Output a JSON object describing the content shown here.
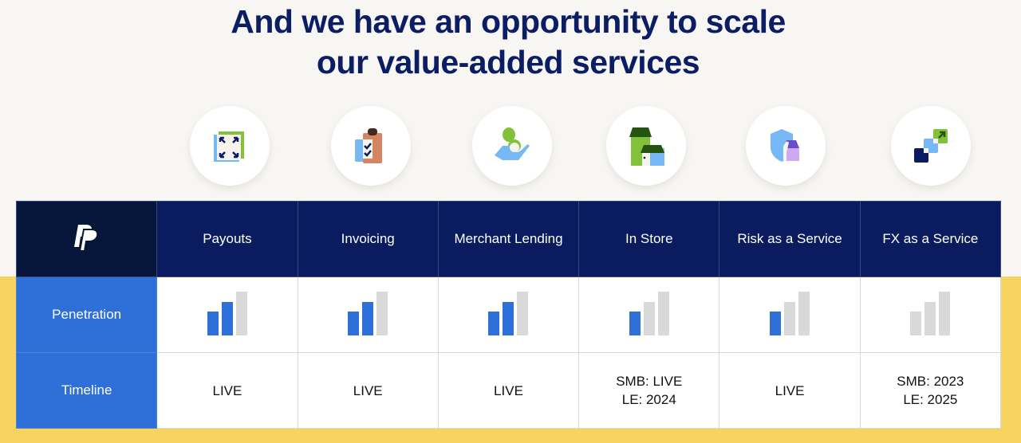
{
  "title_line1": "And we have an opportunity to scale",
  "title_line2": "our value-added services",
  "colors": {
    "navy": "#0a1b5f",
    "blue": "#2f6fd8",
    "bar_filled": "#2f6fd8",
    "bar_empty": "#d9d9d9",
    "yellow": "#f7d35f"
  },
  "row_labels": {
    "penetration": "Penetration",
    "timeline": "Timeline"
  },
  "services": [
    {
      "name": "Payouts",
      "icon": "expand-icon",
      "penetration_bars": 2,
      "timeline": [
        "LIVE"
      ]
    },
    {
      "name": "Invoicing",
      "icon": "clipboard-checklist-icon",
      "penetration_bars": 2,
      "timeline": [
        "LIVE"
      ]
    },
    {
      "name": "Merchant Lending",
      "icon": "hand-money-icon",
      "penetration_bars": 2,
      "timeline": [
        "LIVE"
      ]
    },
    {
      "name": "In Store",
      "icon": "storefront-icon",
      "penetration_bars": 1,
      "timeline": [
        "SMB: LIVE",
        "LE: 2024"
      ]
    },
    {
      "name": "Risk as a Service",
      "icon": "shield-store-icon",
      "penetration_bars": 1,
      "timeline": [
        "LIVE"
      ]
    },
    {
      "name": "FX as a Service",
      "icon": "currency-exchange-icon",
      "penetration_bars": 0,
      "timeline": [
        "SMB: 2023",
        "LE: 2025"
      ]
    }
  ],
  "penetration_max_bars": 3
}
